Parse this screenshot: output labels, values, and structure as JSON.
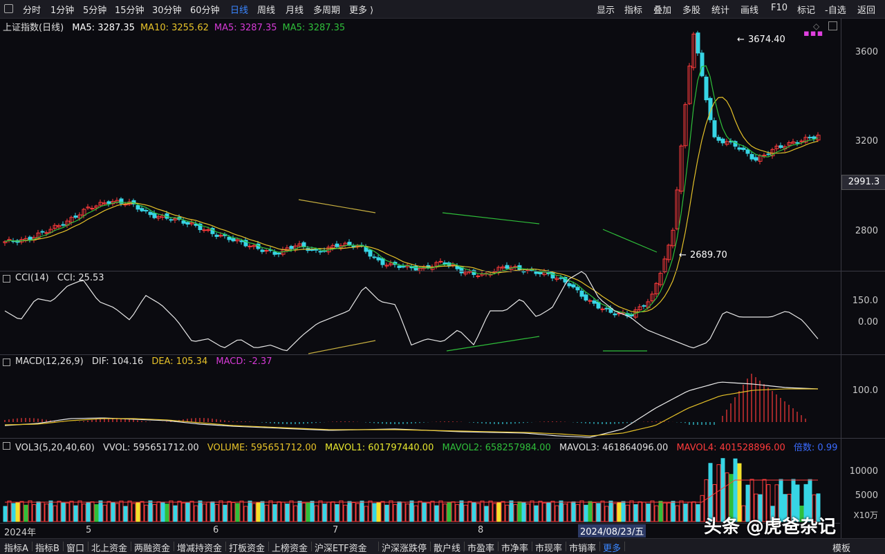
{
  "toolbar": {
    "left_items": [
      "分时",
      "1分钟",
      "5分钟",
      "15分钟",
      "30分钟",
      "60分钟",
      "日线",
      "周线",
      "月线",
      "多周期",
      "更多 ⟩"
    ],
    "active": "日线",
    "right_items": [
      "显示",
      "指标",
      "叠加",
      "多股",
      "统计",
      "画线",
      "F10",
      "标记",
      "-自选",
      "返回"
    ]
  },
  "main": {
    "title": "上证指数(日线)",
    "ma_labels": [
      {
        "text": "MA5: 3287.35",
        "color": "#ffffff"
      },
      {
        "text": "MA10: 3255.62",
        "color": "#e6c229"
      },
      {
        "text": "MA5: 3287.35",
        "color": "#d63ad6"
      },
      {
        "text": "MA5: 3287.35",
        "color": "#2fbf3a"
      }
    ],
    "high_label": "3674.40",
    "low_label": "2689.70",
    "current_price": "2991.3",
    "y_ticks": [
      "3600",
      "3200",
      "2800"
    ]
  },
  "cci": {
    "title": "CCI(14)",
    "value": "CCI: 25.53",
    "y_ticks": [
      "150.0",
      "0.00"
    ]
  },
  "macd": {
    "title": "MACD(12,26,9)",
    "dif": "DIF: 104.16",
    "dea": "DEA: 105.34",
    "macd": "MACD: -2.37",
    "y_ticks": [
      "100.0"
    ]
  },
  "vol": {
    "title": "VOL3(5,20,40,60)",
    "vvol": "VVOL: 595651712.00",
    "volume": "VOLUME: 595651712.00",
    "mavol1": "MAVOL1: 601797440.00",
    "mavol2": "MAVOL2: 658257984.00",
    "mavol3": "MAVOL3: 461864096.00",
    "mavol4": "MAVOL4: 401528896.00",
    "factor": "倍数: 0.99",
    "y_ticks": [
      "10000",
      "5000"
    ],
    "unit": "X10万"
  },
  "date_axis": {
    "labels": [
      "2024年",
      "5",
      "6",
      "7",
      "8"
    ],
    "cursor_date": "2024/08/23/五"
  },
  "bottombar": {
    "items": [
      "指标A",
      "指标B",
      "窗口",
      "北上资金",
      "两融资金",
      "增减持资金",
      "打板资金",
      "上榜资金",
      "沪深ETF资金",
      "沪深涨跌停",
      "散户线",
      "市盈率",
      "市净率",
      "市现率",
      "市销率",
      "更多"
    ],
    "right_item": "模板"
  },
  "watermark": "头条 @虎爸杂记",
  "colors": {
    "up": "#ff3b3b",
    "down": "#37d5e5",
    "ma_white": "#ffffff",
    "ma_yellow": "#e6c229",
    "ma_green": "#2fbf3a",
    "accent": "#3a86ff"
  }
}
